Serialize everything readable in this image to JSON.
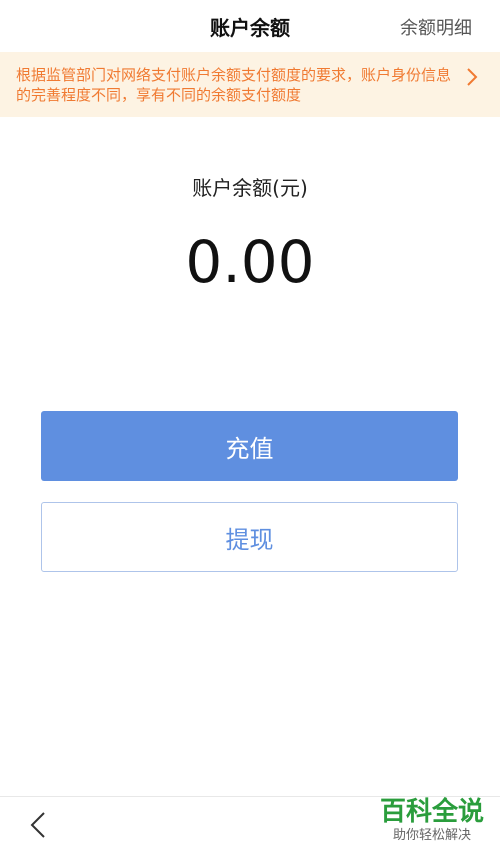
{
  "header": {
    "title": "账户余额",
    "detail_link": "余额明细"
  },
  "notice": {
    "text": "根据监管部门对网络支付账户余额支付额度的要求，账户身份信息的完善程度不同，享有不同的余额支付额度",
    "arrow_icon": "chevron-right-icon",
    "color": "#f07a32",
    "background": "#fdf3e3"
  },
  "balance": {
    "label": "账户余额(元)",
    "value": "0.00"
  },
  "actions": {
    "recharge_label": "充值",
    "withdraw_label": "提现",
    "accent": "#5f8fe0"
  },
  "footer": {
    "back_icon": "chevron-left-icon",
    "watermark_title": "百科全说",
    "watermark_subtitle": "助你轻松解决"
  }
}
